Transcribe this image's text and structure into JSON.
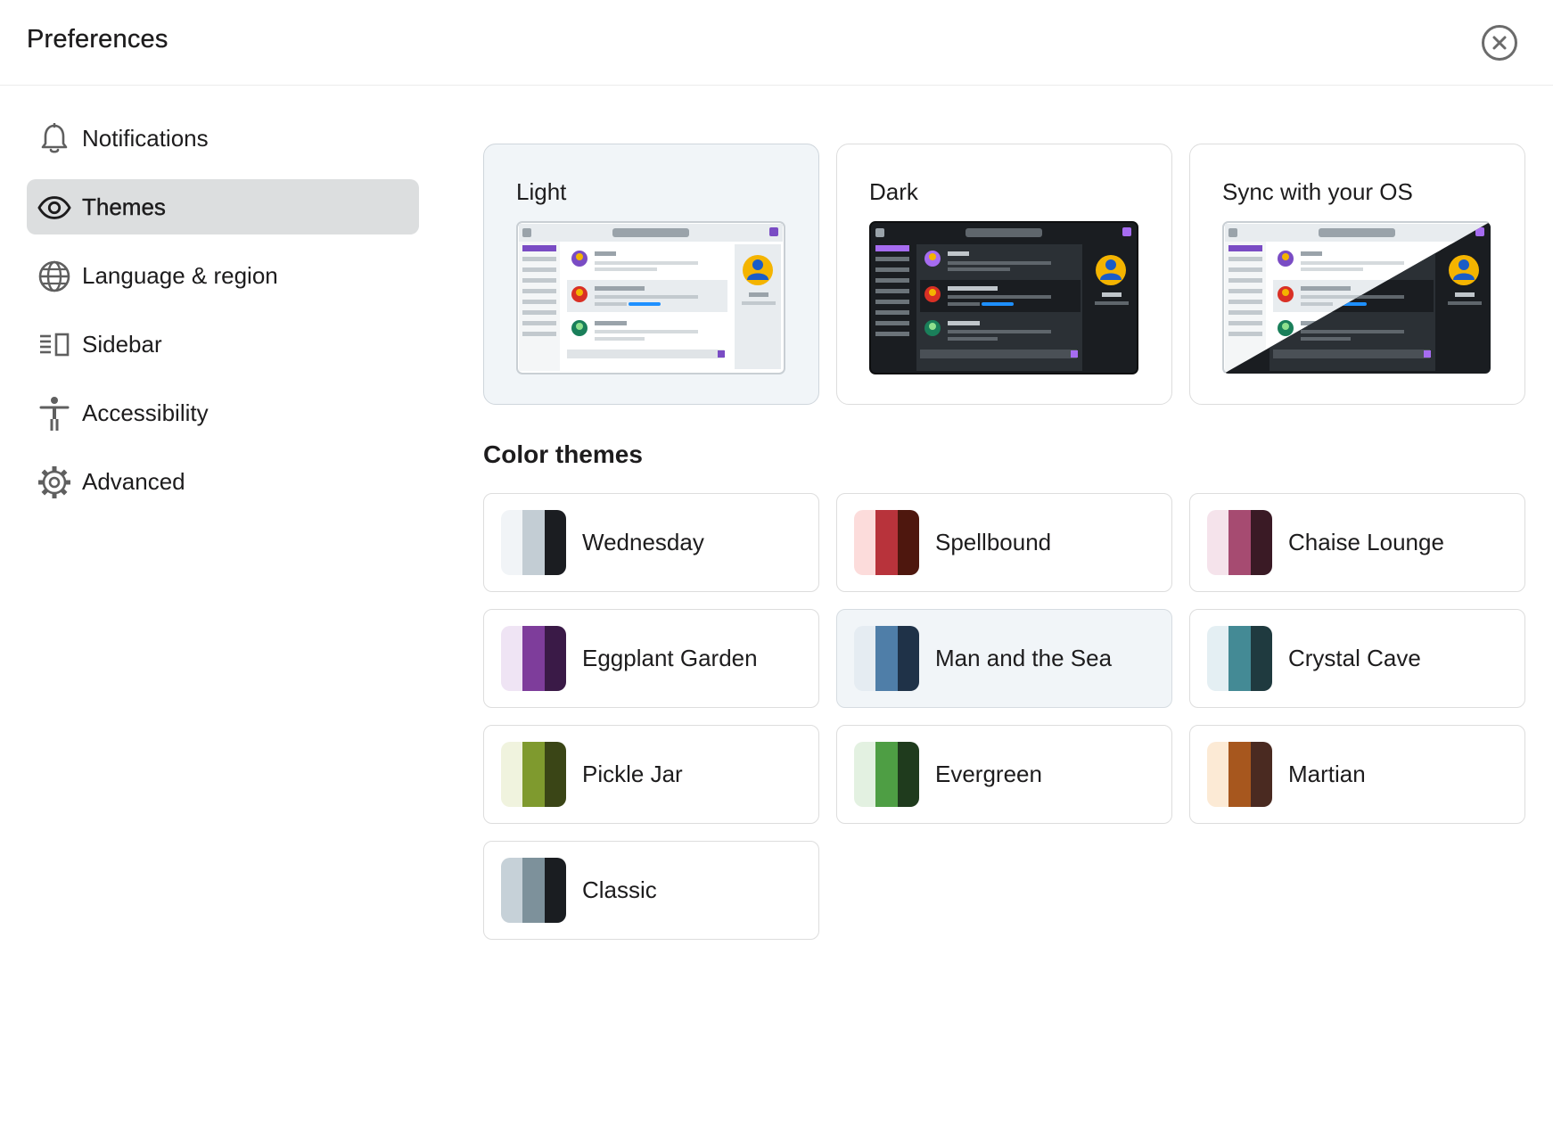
{
  "header": {
    "title": "Preferences"
  },
  "sidebar": {
    "items": [
      {
        "label": "Notifications",
        "icon": "bell-icon",
        "active": false
      },
      {
        "label": "Themes",
        "icon": "eye-icon",
        "active": true
      },
      {
        "label": "Language & region",
        "icon": "globe-icon",
        "active": false
      },
      {
        "label": "Sidebar",
        "icon": "sidebar-icon",
        "active": false
      },
      {
        "label": "Accessibility",
        "icon": "accessibility-icon",
        "active": false
      },
      {
        "label": "Advanced",
        "icon": "gear-icon",
        "active": false
      }
    ]
  },
  "modes": [
    {
      "label": "Light",
      "selected": true
    },
    {
      "label": "Dark",
      "selected": false
    },
    {
      "label": "Sync with your OS",
      "selected": false
    }
  ],
  "color_themes": {
    "title": "Color themes",
    "items": [
      {
        "name": "Wednesday",
        "colors": [
          "#f1f4f7",
          "#c3cdd4",
          "#1b1d21"
        ]
      },
      {
        "name": "Spellbound",
        "colors": [
          "#fcdcdb",
          "#b8333b",
          "#4e170e"
        ]
      },
      {
        "name": "Chaise Lounge",
        "colors": [
          "#f5e3eb",
          "#a64b71",
          "#3a1a25"
        ]
      },
      {
        "name": "Eggplant Garden",
        "colors": [
          "#efe4f4",
          "#7e3d9b",
          "#3a1a47"
        ]
      },
      {
        "name": "Man and the Sea",
        "colors": [
          "#e5ecf2",
          "#4f7ea8",
          "#1f3248"
        ]
      },
      {
        "name": "Crystal Cave",
        "colors": [
          "#e4eff3",
          "#448a95",
          "#1f3a3f"
        ]
      },
      {
        "name": "Pickle Jar",
        "colors": [
          "#f0f3de",
          "#7f9a2e",
          "#3a4516"
        ]
      },
      {
        "name": "Evergreen",
        "colors": [
          "#e3f1e1",
          "#4e9e44",
          "#1f3b1d"
        ]
      },
      {
        "name": "Martian",
        "colors": [
          "#fcead5",
          "#a7571e",
          "#4a2a21"
        ]
      },
      {
        "name": "Classic",
        "colors": [
          "#c6d1d8",
          "#7d919b",
          "#1a1d21"
        ]
      }
    ]
  },
  "colors": {
    "accent_purple": "#7a4cc4",
    "avatar_yellow": "#f4b400",
    "link_blue": "#1e90ff"
  }
}
